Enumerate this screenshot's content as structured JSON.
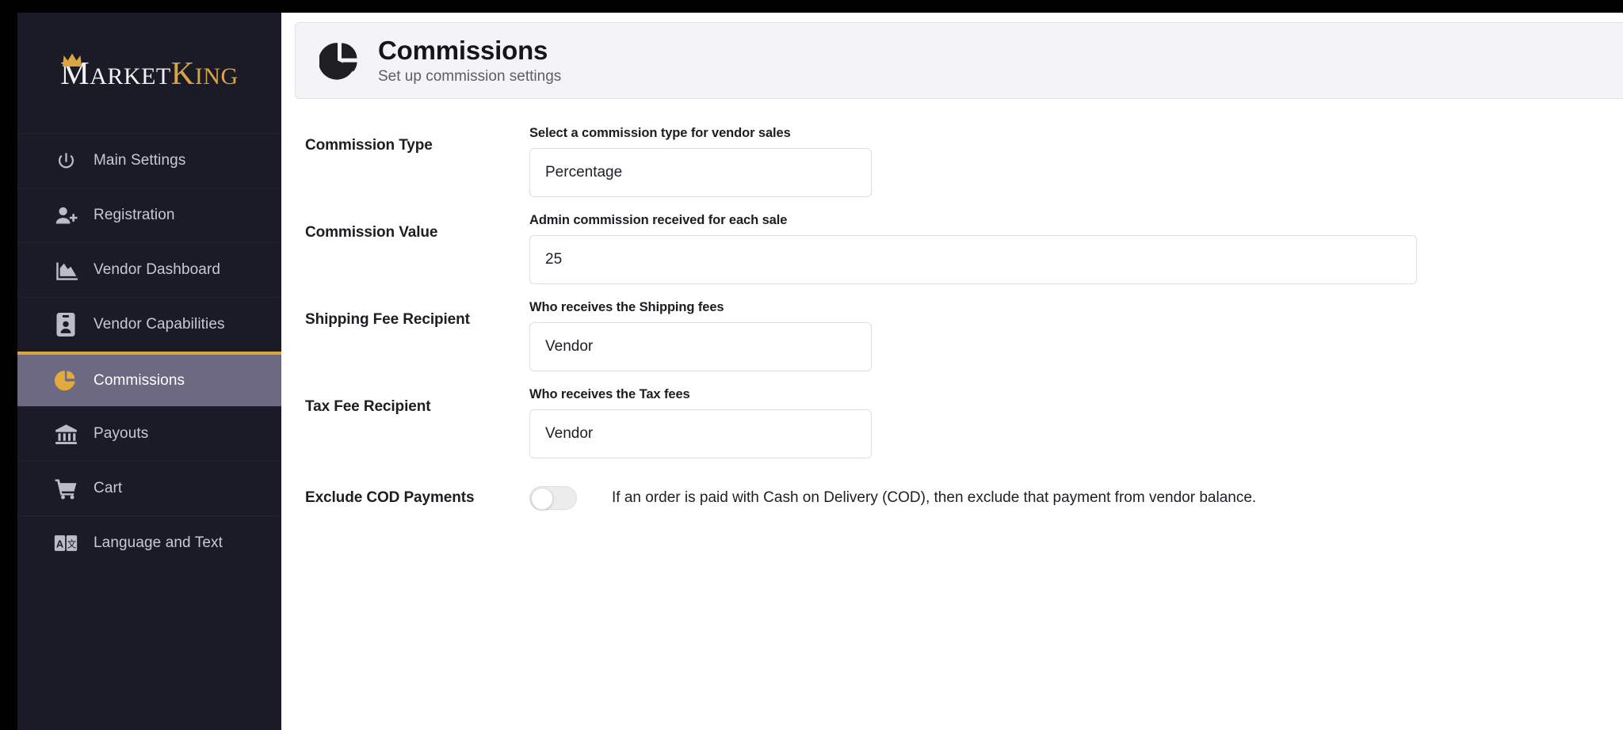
{
  "brand": {
    "name_part1": "Market",
    "name_part2": "King",
    "m": "M",
    "arket": "ARKET",
    "k": "K",
    "ing": "ING",
    "crown_icon": "crown-icon"
  },
  "sidebar": {
    "items": [
      {
        "label": "Main Settings",
        "icon": "power-icon",
        "active": false
      },
      {
        "label": "Registration",
        "icon": "user-plus-icon",
        "active": false
      },
      {
        "label": "Vendor Dashboard",
        "icon": "area-chart-icon",
        "active": false
      },
      {
        "label": "Vendor Capabilities",
        "icon": "id-badge-icon",
        "active": false
      },
      {
        "label": "Commissions",
        "icon": "pie-chart-icon",
        "active": true
      },
      {
        "label": "Payouts",
        "icon": "bank-icon",
        "active": false
      },
      {
        "label": "Cart",
        "icon": "shopping-cart-icon",
        "active": false
      },
      {
        "label": "Language and Text",
        "icon": "translate-icon",
        "active": false
      }
    ]
  },
  "header": {
    "icon": "pie-chart-icon",
    "title": "Commissions",
    "subtitle": "Set up commission settings"
  },
  "form": {
    "rows": [
      {
        "label": "Commission Type",
        "help": "Select a commission type for vendor sales",
        "value": "Percentage",
        "control": "select"
      },
      {
        "label": "Commission Value",
        "help": "Admin commission received for each sale",
        "value": "25",
        "control": "input"
      },
      {
        "label": "Shipping Fee Recipient",
        "help": "Who receives the Shipping fees",
        "value": "Vendor",
        "control": "select"
      },
      {
        "label": "Tax Fee Recipient",
        "help": "Who receives the Tax fees",
        "value": "Vendor",
        "control": "select"
      }
    ],
    "toggle_row": {
      "label": "Exclude COD Payments",
      "description": "If an order is paid with Cash on Delivery (COD), then exclude that payment from vendor balance.",
      "state": "off"
    }
  },
  "colors": {
    "sidebar_bg": "#1b1b27",
    "active_bg": "#6d6982",
    "accent_gold": "#d9a441",
    "header_bg": "#f4f4f6",
    "text_dark": "#1d1d22"
  }
}
